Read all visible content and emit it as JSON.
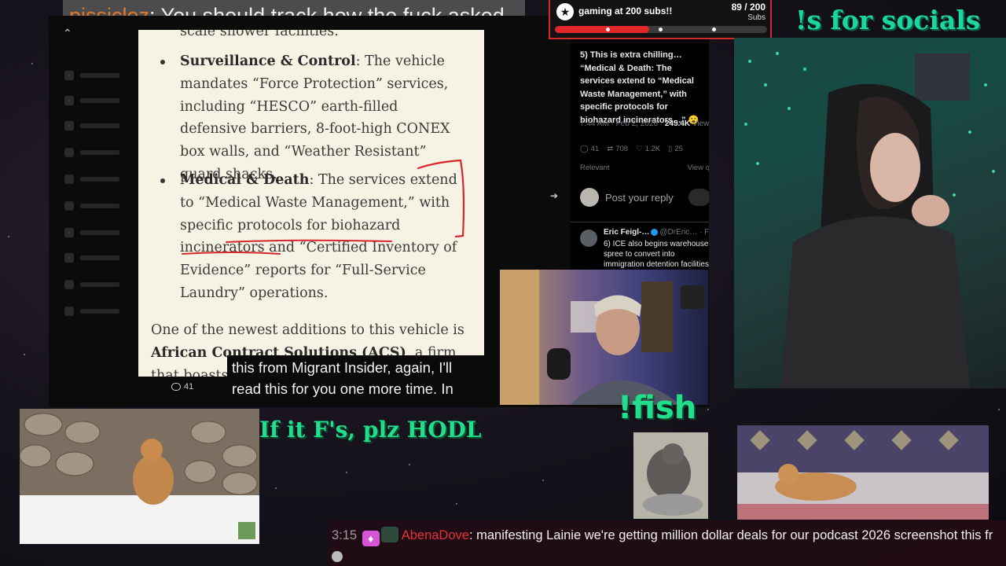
{
  "top_chat": {
    "username": "pissiclez",
    "message": "You should track how the fuck asked"
  },
  "document": {
    "fragment_top": "scale shower facilities.",
    "bullets": [
      {
        "heading": "Surveillance & Control",
        "text": ": The vehicle mandates “Force Protection” services, including “HESCO” earth-filled defensive barriers, 8-foot-high CONEX box walls, and “Weather Resistant” guard shacks."
      },
      {
        "heading": "Medical & Death",
        "text": ": The services extend to “Medical Waste Management,” with specific protocols for biohazard incinerators and “Certified Inventory of Evidence” reports for “Full-Service Laundry” operations."
      }
    ],
    "paragraph_lead": "One of the newest additions to this vehicle is ",
    "paragraph_strong": "African Contract Solutions (ACS)",
    "paragraph_tail": ", a firm that boasts “Roc",
    "comment_count": "41"
  },
  "subtitles": {
    "line1": "this from Migrant Insider, again, I'll",
    "line2": "read this for you one more time. In"
  },
  "tweet": {
    "text": "5) This is extra chilling… “Medical & Death: The services extend to “Medical Waste Management,” with specific protocols for biohazard incinerators…” 😮",
    "time": "7:44 AM · Feb 2, 2026 · ",
    "views": "245.4K",
    "views_label": " Views",
    "replies": "41",
    "reposts": "708",
    "likes": "1.2K",
    "bookmarks": "25",
    "relevant_label": "Relevant",
    "view_quotes": "View q",
    "reply_placeholder": "Post your reply",
    "reply2_name": "Eric Feigl-…",
    "reply2_handle": "@DrEric… · Fe",
    "reply2_text": "6) ICE also begins warehouse spree to convert into immigration detention facilities."
  },
  "sub_goal": {
    "title": "gaming at 200 subs!!",
    "count": "89 / 200",
    "unit": "Subs",
    "progress": 0.445,
    "bar_color": "#e02828"
  },
  "overlays": {
    "socials": "!s for socials :)",
    "fish": "!fish",
    "hodl": "If it F's, plz HODL"
  },
  "bottom_chat": {
    "time": "3:15",
    "username": "AbenaDove",
    "message": "manifesting Lainie we're getting million dollar deals for our podcast 2026 screenshot this fr"
  },
  "colors": {
    "accent_green": "#22dd8c",
    "goal_red": "#e02828",
    "chat_user_orange": "#e07a28",
    "chat_user_red": "#e5323a"
  }
}
